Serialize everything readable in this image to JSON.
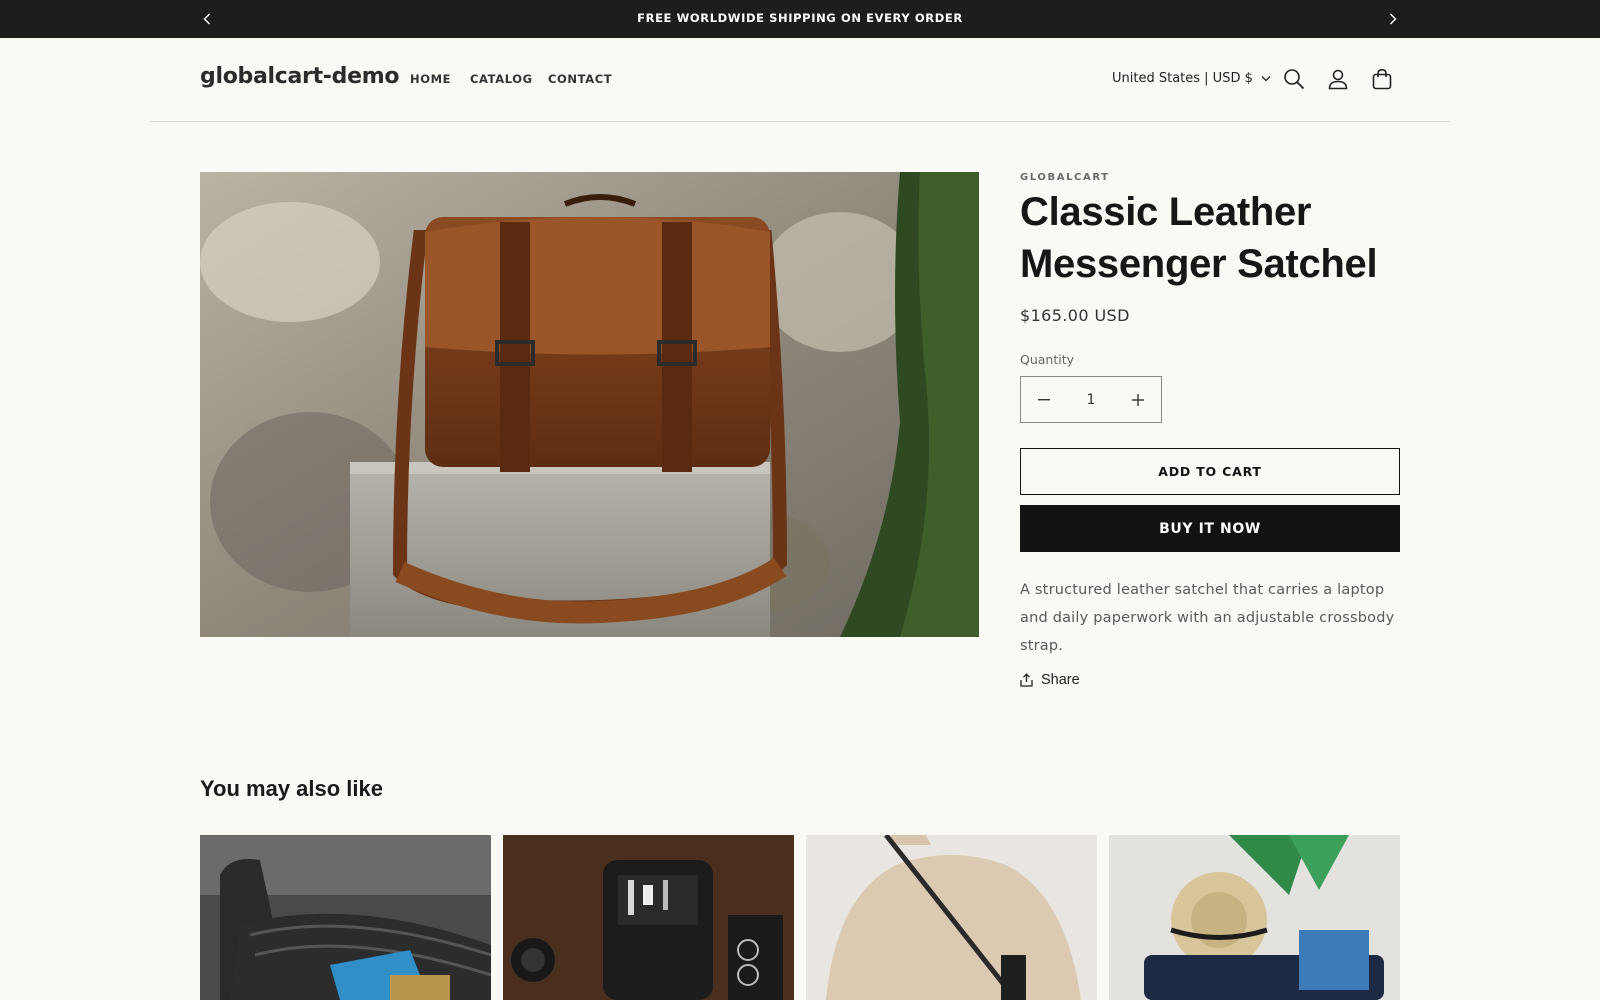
{
  "announcement": {
    "text": "FREE WORLDWIDE SHIPPING ON EVERY ORDER",
    "prev_icon": "chevron-left-icon",
    "next_icon": "chevron-right-icon"
  },
  "header": {
    "logo": "globalcart-demo",
    "nav": [
      {
        "label": "HOME"
      },
      {
        "label": "CATALOG"
      },
      {
        "label": "CONTACT"
      }
    ],
    "locale": "United States | USD $",
    "icons": [
      "search-icon",
      "account-icon",
      "cart-icon"
    ]
  },
  "product": {
    "image": "brown leather messenger bag on granite stone",
    "vendor": "GLOBALCART",
    "title": "Classic Leather Messenger Satchel",
    "price": "$165.00 USD",
    "quantity_label": "Quantity",
    "quantity": "1",
    "add_to_cart": "ADD TO CART",
    "buy_now": "BUY IT NOW",
    "description": "A structured leather satchel that carries a laptop and daily paperwork with an adjustable crossbody strap.",
    "share": "Share"
  },
  "recommendations": {
    "title": "You may also like",
    "cards": [
      {
        "image": "black luggage with blue tag"
      },
      {
        "image": "leather tech organizer with headphones"
      },
      {
        "image": "person in beige sweater with crossbody strap"
      },
      {
        "image": "open suitcase with straw hat and plant"
      }
    ]
  },
  "colors": {
    "background": "#faf9f6",
    "announcement_bg": "#1d1d1d",
    "primary_button": "#121212"
  }
}
